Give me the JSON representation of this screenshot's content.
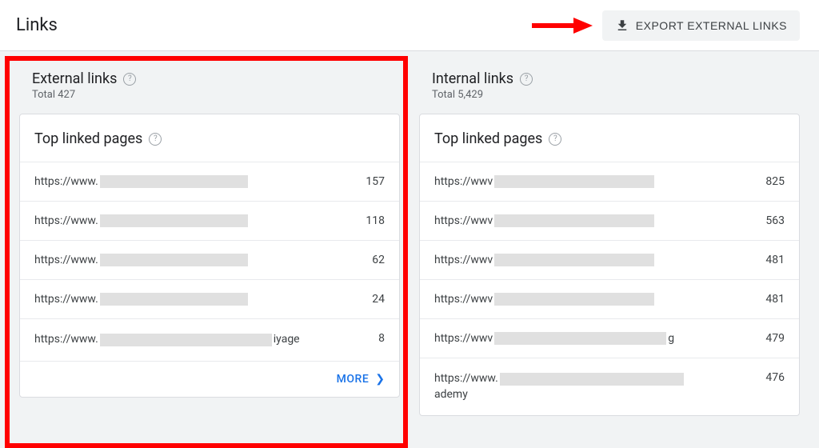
{
  "header": {
    "title": "Links",
    "export_label": "EXPORT EXTERNAL LINKS"
  },
  "external": {
    "title": "External links",
    "subtitle": "Total 427",
    "card_title": "Top linked pages",
    "rows": [
      {
        "prefix": "https://www.",
        "redact_w": 185,
        "suffix": "",
        "count": "157"
      },
      {
        "prefix": "https://www.",
        "redact_w": 185,
        "suffix": "",
        "count": "118"
      },
      {
        "prefix": "https://www.",
        "redact_w": 185,
        "suffix": "",
        "count": "62"
      },
      {
        "prefix": "https://www.",
        "redact_w": 185,
        "suffix": "",
        "count": "24"
      },
      {
        "prefix": "https://www.",
        "redact_w": 215,
        "suffix": "iyage",
        "count": "8",
        "wrap": true
      }
    ],
    "more_label": "MORE"
  },
  "internal": {
    "title": "Internal links",
    "subtitle": "Total 5,429",
    "card_title": "Top linked pages",
    "rows": [
      {
        "prefix": "https://wwv",
        "redact_w": 200,
        "suffix": "",
        "count": "825"
      },
      {
        "prefix": "https://wwv",
        "redact_w": 200,
        "suffix": "",
        "count": "563"
      },
      {
        "prefix": "https://wwv",
        "redact_w": 200,
        "suffix": "",
        "count": "481"
      },
      {
        "prefix": "https://wwv",
        "redact_w": 200,
        "suffix": "",
        "count": "481"
      },
      {
        "prefix": "https://wwv",
        "redact_w": 215,
        "suffix": "g",
        "count": "479"
      },
      {
        "prefix": "https://www.",
        "redact_w": 230,
        "suffix": "ademy",
        "count": "476",
        "wrap": true
      }
    ]
  }
}
